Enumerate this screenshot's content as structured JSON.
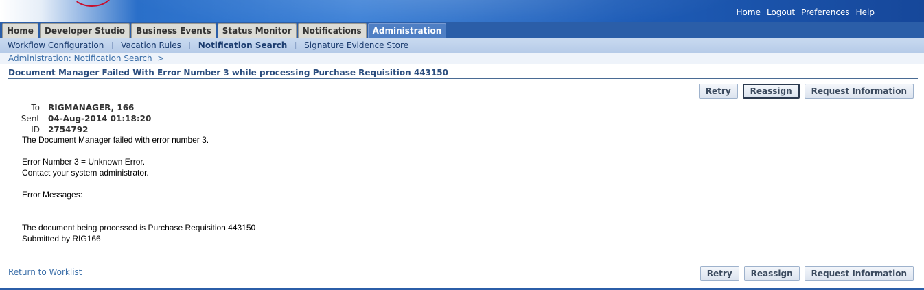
{
  "global_links": [
    "Home",
    "Logout",
    "Preferences",
    "Help"
  ],
  "tabs": [
    {
      "label": "Home",
      "active": false
    },
    {
      "label": "Developer Studio",
      "active": false
    },
    {
      "label": "Business Events",
      "active": false
    },
    {
      "label": "Status Monitor",
      "active": false
    },
    {
      "label": "Notifications",
      "active": false
    },
    {
      "label": "Administration",
      "active": true
    }
  ],
  "subnav": [
    {
      "label": "Workflow Configuration",
      "selected": false
    },
    {
      "label": "Vacation Rules",
      "selected": false
    },
    {
      "label": "Notification Search",
      "selected": true
    },
    {
      "label": "Signature Evidence Store",
      "selected": false
    }
  ],
  "breadcrumb": "Administration: Notification Search  >",
  "page_title": "Document Manager Failed With Error Number 3 while processing Purchase Requisition 443150",
  "buttons": {
    "retry": "Retry",
    "reassign": "Reassign",
    "request_info": "Request Information"
  },
  "meta": {
    "to_label": "To",
    "to_value": "RIGMANAGER, 166",
    "sent_label": "Sent",
    "sent_value": "04-Aug-2014 01:18:20",
    "id_label": "ID",
    "id_value": "2754792"
  },
  "message": {
    "line1": "The Document Manager failed with error number 3.",
    "line2": "Error Number 3 = Unknown Error.",
    "line3": "Contact your system administrator.",
    "line4": "Error Messages:",
    "line5": "The document being processed is Purchase Requisition 443150",
    "line6": "Submitted by RIG166"
  },
  "return_link": "Return to Worklist"
}
